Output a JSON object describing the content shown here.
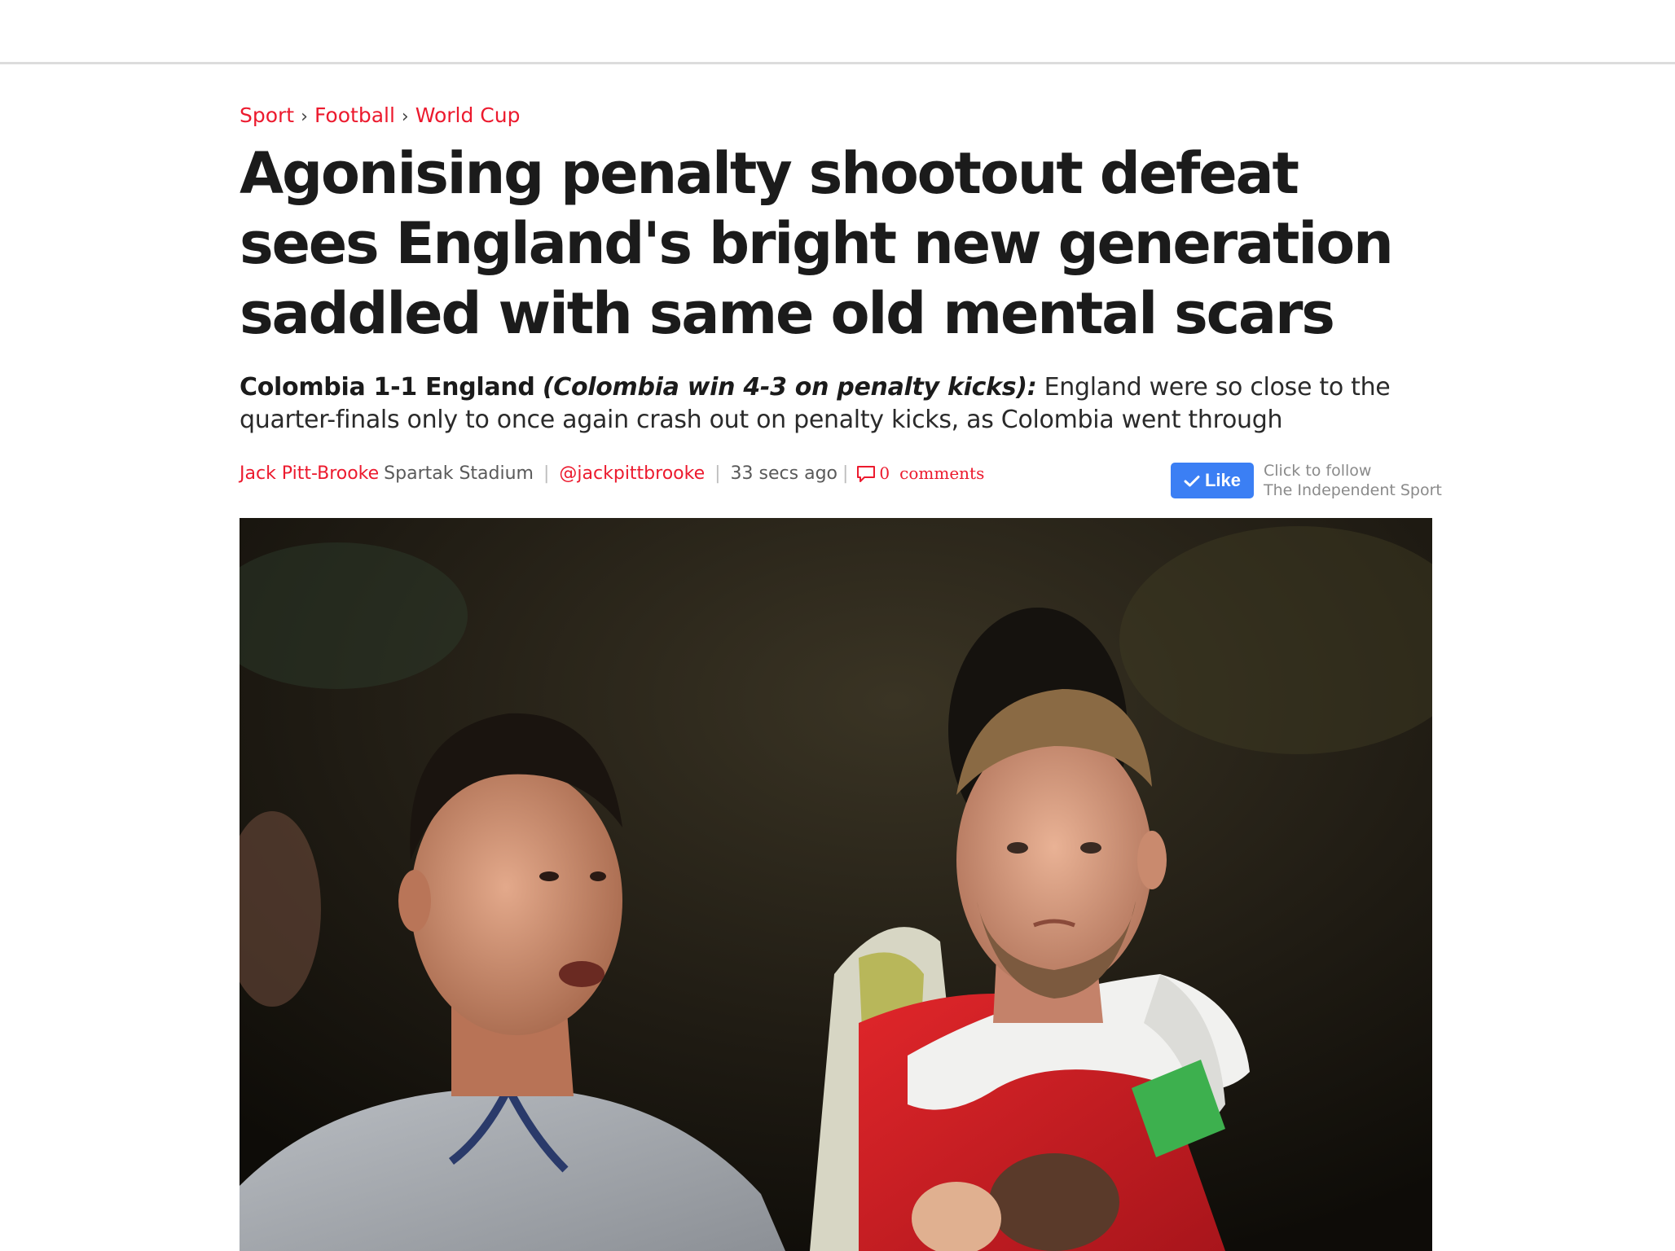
{
  "breadcrumb": {
    "items": [
      "Sport",
      "Football",
      "World Cup"
    ],
    "separator": "›"
  },
  "article": {
    "headline": "Agonising penalty shootout defeat sees England's bright new generation saddled with same old mental scars",
    "standfirst": {
      "score": "Colombia 1-1 England",
      "penalties": "(Colombia win 4-3 on penalty kicks)",
      "colon": ":",
      "summary": " England were so close to the quarter-finals only to once again crash out on penalty kicks, as Colombia went through"
    },
    "byline": {
      "author": "Jack Pitt-Brooke",
      "location": "Spartak Stadium",
      "twitter_handle": "@jackpittbrooke",
      "timestamp": "33 secs ago",
      "comment_count": "0",
      "comments_label": "comments"
    }
  },
  "follow": {
    "like_label": "Like",
    "line1": "Click to follow",
    "line2": "The Independent Sport"
  },
  "hero_image": {
    "subject": "photo-england-players"
  },
  "colors": {
    "accent_red": "#ec1a2e",
    "like_blue": "#3b7ff4",
    "headline": "#1b1b1b"
  }
}
